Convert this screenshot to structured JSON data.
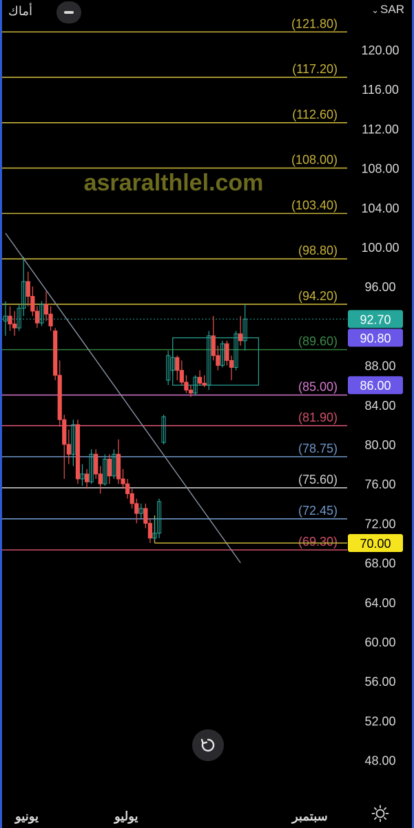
{
  "header": {
    "name": "أماك",
    "currency": "SAR"
  },
  "icons": {
    "collapse": "minus-icon",
    "currency_toggle": "chevron-down-icon",
    "reset": "reset-icon",
    "settings": "sun-settings-icon"
  },
  "watermark": "asraralthlel.com",
  "x_axis": {
    "labels": [
      "يونيو",
      "يوليو",
      "سبتمبر"
    ]
  },
  "chart_data": {
    "type": "candlestick",
    "y_axis": {
      "ticks": [
        "120.00",
        "116.00",
        "112.00",
        "108.00",
        "104.00",
        "100.00",
        "96.00",
        "88.00",
        "84.00",
        "80.00",
        "76.00",
        "72.00",
        "68.00",
        "64.00",
        "60.00",
        "56.00",
        "52.00",
        "48.00"
      ],
      "ylim": [
        44.8,
        121.8
      ]
    },
    "horizontal_levels": [
      {
        "label": "(121.80)",
        "value": 121.8,
        "color": "#c8b43a",
        "text_color": "#c8b43a"
      },
      {
        "label": "(117.20)",
        "value": 117.2,
        "color": "#c8b43a",
        "text_color": "#c8b43a"
      },
      {
        "label": "(112.60)",
        "value": 112.6,
        "color": "#c8b43a",
        "text_color": "#c8b43a"
      },
      {
        "label": "(108.00)",
        "value": 108.0,
        "color": "#c8b43a",
        "text_color": "#c8b43a"
      },
      {
        "label": "(103.40)",
        "value": 103.4,
        "color": "#c8b43a",
        "text_color": "#c8b43a"
      },
      {
        "label": "(98.80)",
        "value": 98.8,
        "color": "#c8b43a",
        "text_color": "#c8b43a"
      },
      {
        "label": "(94.20)",
        "value": 94.2,
        "color": "#c8b43a",
        "text_color": "#c8b43a"
      },
      {
        "label": "(89.60)",
        "value": 89.6,
        "color": "#2f7a3a",
        "text_color": "#3c8a4a"
      },
      {
        "label": "(85.00)",
        "value": 85.0,
        "color": "#d77ad0",
        "text_color": "#d77ad0"
      },
      {
        "label": "(81.90)",
        "value": 81.9,
        "color": "#d0506a",
        "text_color": "#d0506a"
      },
      {
        "label": "(78.75)",
        "value": 78.75,
        "color": "#6f97c8",
        "text_color": "#6f97c8"
      },
      {
        "label": "(75.60)",
        "value": 75.6,
        "color": "#c8c8c8",
        "text_color": "#d0d0d0"
      },
      {
        "label": "(72.45)",
        "value": 72.45,
        "color": "#6f97c8",
        "text_color": "#6f97c8"
      },
      {
        "label": "(69.30)",
        "value": 69.3,
        "color": "#d0506a",
        "text_color": "#d0506a"
      }
    ],
    "price_badges": [
      {
        "label": "92.70",
        "value": 92.7,
        "bg": "#26a69a",
        "fg": "#ffffff"
      },
      {
        "label": "90.80",
        "value": 90.8,
        "bg": "#6a57e8",
        "fg": "#ffffff"
      },
      {
        "label": "86.00",
        "value": 86.0,
        "bg": "#6a57e8",
        "fg": "#ffffff"
      },
      {
        "label": "70.00",
        "value": 70.0,
        "bg": "#f6e51e",
        "fg": "#000000"
      }
    ],
    "current_price": 92.7,
    "colors": {
      "up": "#26a69a",
      "down": "#ef5350",
      "trendline": "#8a94a6"
    },
    "trendline": {
      "from": {
        "bar": 0,
        "price": 101.4
      },
      "to": {
        "bar": 52,
        "price": 68.0
      }
    },
    "rectangles": [
      {
        "from_bar": 37,
        "to_bar": 56,
        "top": 90.8,
        "bottom": 86.0,
        "color": "#26a69a"
      },
      {
        "from_bar": 33,
        "to_bar": 56,
        "top": 70.0,
        "bottom": 70.0,
        "color": "#c8b43a"
      }
    ],
    "candles": [
      {
        "o": 92.5,
        "h": 94.5,
        "l": 91.0,
        "c": 93.0
      },
      {
        "o": 93.0,
        "h": 94.0,
        "l": 91.5,
        "c": 92.2
      },
      {
        "o": 92.2,
        "h": 93.5,
        "l": 91.0,
        "c": 91.8
      },
      {
        "o": 91.8,
        "h": 94.2,
        "l": 91.5,
        "c": 93.8
      },
      {
        "o": 93.8,
        "h": 99.0,
        "l": 93.0,
        "c": 96.5
      },
      {
        "o": 96.5,
        "h": 97.5,
        "l": 94.0,
        "c": 95.0
      },
      {
        "o": 95.0,
        "h": 96.0,
        "l": 93.0,
        "c": 93.5
      },
      {
        "o": 93.5,
        "h": 94.0,
        "l": 91.8,
        "c": 92.3
      },
      {
        "o": 92.3,
        "h": 94.5,
        "l": 92.0,
        "c": 94.2
      },
      {
        "o": 94.2,
        "h": 95.5,
        "l": 92.5,
        "c": 93.2
      },
      {
        "o": 93.2,
        "h": 94.0,
        "l": 91.5,
        "c": 92.0
      },
      {
        "o": 91.5,
        "h": 91.8,
        "l": 86.5,
        "c": 87.0
      },
      {
        "o": 87.0,
        "h": 88.5,
        "l": 81.8,
        "c": 82.5
      },
      {
        "o": 82.5,
        "h": 83.0,
        "l": 76.5,
        "c": 80.0
      },
      {
        "o": 80.0,
        "h": 81.5,
        "l": 78.0,
        "c": 79.0
      },
      {
        "o": 79.0,
        "h": 82.5,
        "l": 77.8,
        "c": 82.0
      },
      {
        "o": 82.0,
        "h": 82.5,
        "l": 76.0,
        "c": 76.5
      },
      {
        "o": 76.5,
        "h": 78.0,
        "l": 75.8,
        "c": 77.0
      },
      {
        "o": 77.0,
        "h": 77.5,
        "l": 75.5,
        "c": 76.2
      },
      {
        "o": 76.2,
        "h": 79.5,
        "l": 76.0,
        "c": 79.0
      },
      {
        "o": 79.0,
        "h": 79.5,
        "l": 76.5,
        "c": 77.0
      },
      {
        "o": 77.0,
        "h": 77.8,
        "l": 75.0,
        "c": 76.0
      },
      {
        "o": 76.0,
        "h": 79.0,
        "l": 75.8,
        "c": 78.5
      },
      {
        "o": 78.5,
        "h": 79.0,
        "l": 76.0,
        "c": 76.8
      },
      {
        "o": 76.8,
        "h": 79.5,
        "l": 76.5,
        "c": 79.0
      },
      {
        "o": 79.0,
        "h": 80.5,
        "l": 76.0,
        "c": 76.5
      },
      {
        "o": 76.5,
        "h": 77.5,
        "l": 75.5,
        "c": 76.0
      },
      {
        "o": 76.0,
        "h": 76.5,
        "l": 74.5,
        "c": 75.0
      },
      {
        "o": 75.0,
        "h": 75.5,
        "l": 73.5,
        "c": 74.0
      },
      {
        "o": 74.0,
        "h": 74.5,
        "l": 72.0,
        "c": 73.0
      },
      {
        "o": 73.0,
        "h": 74.0,
        "l": 72.5,
        "c": 73.5
      },
      {
        "o": 73.5,
        "h": 74.0,
        "l": 71.5,
        "c": 72.0
      },
      {
        "o": 72.0,
        "h": 72.5,
        "l": 70.0,
        "c": 70.5
      },
      {
        "o": 70.5,
        "h": 72.5,
        "l": 70.3,
        "c": 71.0
      },
      {
        "o": 71.0,
        "h": 74.5,
        "l": 70.5,
        "c": 74.2
      },
      {
        "o": 80.2,
        "h": 83.0,
        "l": 80.0,
        "c": 82.8
      },
      {
        "o": 86.5,
        "h": 89.5,
        "l": 86.0,
        "c": 89.0
      },
      {
        "o": 87.5,
        "h": 89.5,
        "l": 87.0,
        "c": 88.8
      },
      {
        "o": 88.8,
        "h": 89.0,
        "l": 86.5,
        "c": 87.5
      },
      {
        "o": 87.5,
        "h": 88.5,
        "l": 86.0,
        "c": 86.3
      },
      {
        "o": 86.3,
        "h": 87.0,
        "l": 85.2,
        "c": 85.5
      },
      {
        "o": 85.5,
        "h": 86.0,
        "l": 84.8,
        "c": 85.2
      },
      {
        "o": 85.2,
        "h": 87.0,
        "l": 85.0,
        "c": 86.8
      },
      {
        "o": 86.8,
        "h": 87.5,
        "l": 86.0,
        "c": 86.2
      },
      {
        "o": 86.2,
        "h": 87.0,
        "l": 85.8,
        "c": 86.0
      },
      {
        "o": 86.0,
        "h": 91.5,
        "l": 85.5,
        "c": 91.0
      },
      {
        "o": 91.0,
        "h": 93.0,
        "l": 88.5,
        "c": 89.0
      },
      {
        "o": 89.0,
        "h": 90.0,
        "l": 87.5,
        "c": 88.0
      },
      {
        "o": 88.0,
        "h": 90.5,
        "l": 87.8,
        "c": 90.2
      },
      {
        "o": 90.2,
        "h": 90.5,
        "l": 88.0,
        "c": 88.5
      },
      {
        "o": 88.5,
        "h": 89.0,
        "l": 86.5,
        "c": 87.8
      },
      {
        "o": 87.8,
        "h": 91.5,
        "l": 87.5,
        "c": 91.2
      },
      {
        "o": 91.2,
        "h": 93.0,
        "l": 90.0,
        "c": 90.5
      },
      {
        "o": 90.5,
        "h": 94.2,
        "l": 89.5,
        "c": 92.7
      }
    ]
  }
}
